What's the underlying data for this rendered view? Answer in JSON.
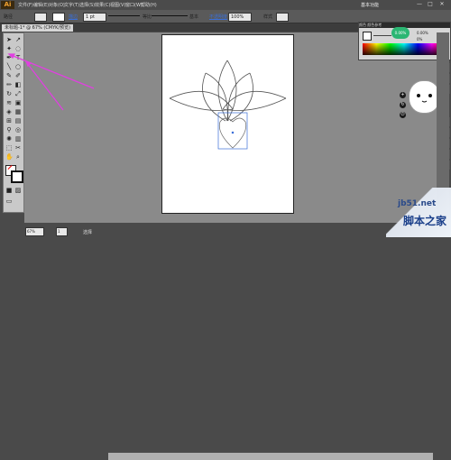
{
  "app": {
    "logo": "Ai",
    "workspace": "基本功能"
  },
  "menu": [
    "文件(F)",
    "编辑(E)",
    "对象(O)",
    "文字(T)",
    "选择(S)",
    "效果(C)",
    "视图(V)",
    "窗口(W)",
    "帮助(H)"
  ],
  "window_controls": [
    "—",
    "□",
    "✕"
  ],
  "control_bar": {
    "mode": "路径",
    "stroke_label": "描边",
    "stroke_weight": "1 pt",
    "profile_label": "等比",
    "brush_label": "基本",
    "opacity_label": "不透明度",
    "opacity_value": "100%",
    "style_label": "样式"
  },
  "document_tab": "未标题-1* @ 67% (CMYK/预览)",
  "color_panel": {
    "title": "颜色   颜色参考",
    "green_button": "0.00%",
    "rgb_c": "0.00%",
    "rgb_k": "0%"
  },
  "status": {
    "zoom": "67%",
    "page": "1",
    "tool": "选择"
  },
  "watermark": {
    "url": "jb51.net",
    "text": "脚本之家"
  },
  "colors": {
    "accent": "#2bb673",
    "arrow": "#e040e0"
  }
}
